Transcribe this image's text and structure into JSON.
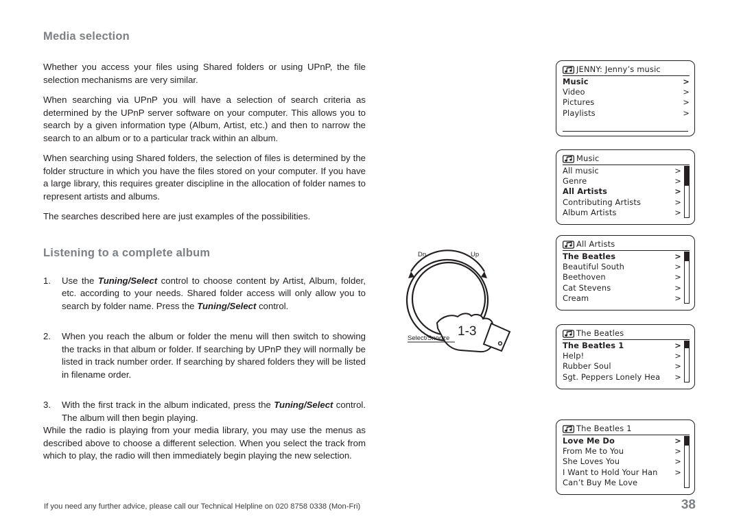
{
  "page": {
    "number": "38",
    "footer_text": "If you need any further advice, please call our Technical Helpline on 020 8758 0338 (Mon-Fri)"
  },
  "sections": {
    "media_selection": {
      "heading": "Media selection",
      "p1": "Whether you access your files using Shared folders or using UPnP, the file selection mechanisms are very similar.",
      "p2": "When searching via UPnP you will have a selection of search criteria as determined by the UPnP server software on your computer. This allows you to search by a given information type (Album, Artist, etc.) and then to narrow the search to an album or to a particular track within an album.",
      "p3": "When searching using Shared folders, the selection of files is determined by the folder structure in which you have the files stored on your computer. If you have a large library, this requires greater discipline in the allocation of folder names to represent artists and albums.",
      "p4": "The searches described here are just examples of the possibilities."
    },
    "listening_album": {
      "heading": "Listening to a complete album",
      "steps": [
        {
          "num": "1.",
          "parts": [
            {
              "text": "Use the ",
              "bold_italic": false
            },
            {
              "text": "Tuning/Select",
              "bold_italic": true
            },
            {
              "text": " control to choose content by Artist, Album, folder, etc. according to your needs. Shared folder access will only allow you to search by folder name. Press the ",
              "bold_italic": false
            },
            {
              "text": "Tuning/Select",
              "bold_italic": true
            },
            {
              "text": " control.",
              "bold_italic": false
            }
          ]
        },
        {
          "num": "2.",
          "parts": [
            {
              "text": "When you reach the album or folder the menu will then switch to showing the tracks in that album or folder. If searching by UPnP they will normally be listed in track number order. If searching by shared folders they will be listed in filename order.",
              "bold_italic": false
            }
          ]
        },
        {
          "num": "3.",
          "parts": [
            {
              "text": "With the first track in the album indicated, press the ",
              "bold_italic": false
            },
            {
              "text": "Tuning/Select",
              "bold_italic": true
            },
            {
              "text": " control. The album will then begin playing.",
              "bold_italic": false
            }
          ]
        }
      ],
      "tail": "While the radio is playing from your media library, you may use the menus as described above to choose a different selection. When you select the track from which to play, the radio will then immediately begin playing the new selection."
    }
  },
  "dial": {
    "label_down": "Dn.",
    "label_up": "Up",
    "label_select": "Select/Snooze",
    "label_steps": "1-3"
  },
  "lcd_screens": [
    {
      "id": "screen-source",
      "icon": "music-note-icon",
      "title": "JENNY: Jenny’s music",
      "scrollbar": false,
      "rows": [
        {
          "label": "Music",
          "arrow": ">",
          "selected": true
        },
        {
          "label": "Video",
          "arrow": ">",
          "selected": false
        },
        {
          "label": "Pictures",
          "arrow": ">",
          "selected": false
        },
        {
          "label": "Playlists",
          "arrow": ">",
          "selected": false
        }
      ]
    },
    {
      "id": "screen-music",
      "icon": "music-note-icon",
      "title": "Music",
      "scrollbar": true,
      "scroll_thumb_top_pct": 0,
      "scroll_thumb_height_pct": 38,
      "rows": [
        {
          "label": "All music",
          "arrow": ">",
          "selected": false
        },
        {
          "label": "Genre",
          "arrow": ">",
          "selected": false
        },
        {
          "label": "All Artists",
          "arrow": ">",
          "selected": true
        },
        {
          "label": "Contributing Artists",
          "arrow": ">",
          "selected": false
        },
        {
          "label": "Album Artists",
          "arrow": ">",
          "selected": false
        }
      ]
    },
    {
      "id": "screen-all-artists",
      "icon": "music-note-icon",
      "title": "All Artists",
      "scrollbar": true,
      "scroll_thumb_top_pct": 0,
      "scroll_thumb_height_pct": 17,
      "rows": [
        {
          "label": "The Beatles",
          "arrow": ">",
          "selected": true
        },
        {
          "label": "Beautiful South",
          "arrow": ">",
          "selected": false
        },
        {
          "label": "Beethoven",
          "arrow": ">",
          "selected": false
        },
        {
          "label": "Cat Stevens",
          "arrow": ">",
          "selected": false
        },
        {
          "label": "Cream",
          "arrow": ">",
          "selected": false
        }
      ]
    },
    {
      "id": "screen-the-beatles",
      "icon": "music-note-icon",
      "title": "The Beatles",
      "scrollbar": true,
      "scroll_thumb_top_pct": 0,
      "scroll_thumb_height_pct": 17,
      "rows": [
        {
          "label": "The Beatles 1",
          "arrow": ">",
          "selected": true
        },
        {
          "label": "Help!",
          "arrow": ">",
          "selected": false
        },
        {
          "label": "Rubber Soul",
          "arrow": ">",
          "selected": false
        },
        {
          "label": "Sgt. Peppers Lonely Hea",
          "arrow": ">",
          "selected": false
        }
      ]
    },
    {
      "id": "screen-the-beatles-1",
      "icon": "music-note-icon",
      "title": "The Beatles 1",
      "scrollbar": true,
      "scroll_thumb_top_pct": 0,
      "scroll_thumb_height_pct": 17,
      "rows": [
        {
          "label": "Love Me Do",
          "arrow": ">",
          "selected": true
        },
        {
          "label": "From Me to You",
          "arrow": ">",
          "selected": false
        },
        {
          "label": "She Loves You",
          "arrow": ">",
          "selected": false
        },
        {
          "label": "I Want to Hold Your Han",
          "arrow": ">",
          "selected": false
        },
        {
          "label": "Can’t Buy Me Love",
          "arrow": "",
          "selected": false
        }
      ]
    }
  ],
  "colors": {
    "heading": "#7c8084",
    "text": "#231f20",
    "lcd_border": "#231f20"
  }
}
